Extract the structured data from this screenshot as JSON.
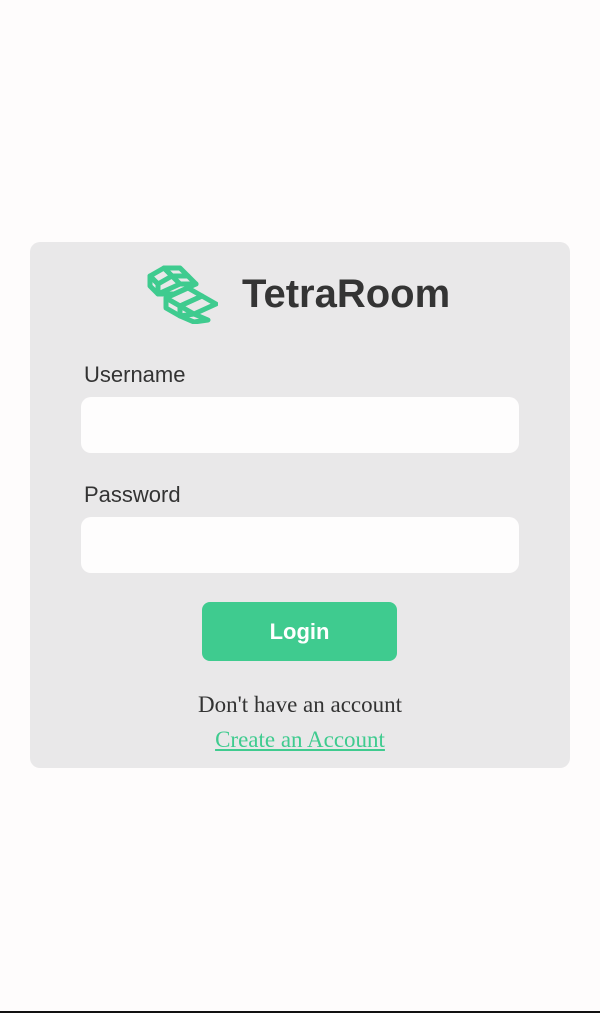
{
  "brand": {
    "name": "TetraRoom",
    "logo_icon": "tetra-cubes-icon",
    "accent_color": "#3fcb8f"
  },
  "form": {
    "username_label": "Username",
    "username_value": "",
    "password_label": "Password",
    "password_value": "",
    "login_label": "Login"
  },
  "signup": {
    "prompt": "Don't have an account",
    "link_label": "Create an Account"
  }
}
